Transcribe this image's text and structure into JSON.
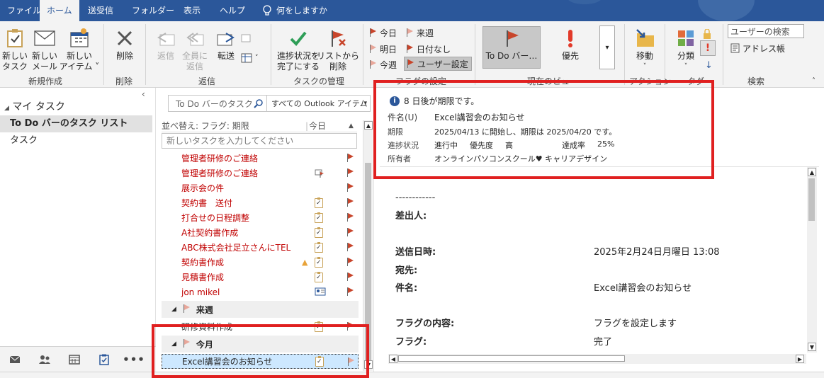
{
  "tabs": [
    {
      "label": "ファイル"
    },
    {
      "label": "ホーム"
    },
    {
      "label": "送受信"
    },
    {
      "label": "フォルダー"
    },
    {
      "label": "表示"
    },
    {
      "label": "ヘルプ"
    },
    {
      "label": "何をしますか"
    }
  ],
  "ribbon": {
    "new_task": "新しい\nタスク",
    "new_mail": "新しい\nメール",
    "new_item": "新しい\nアイテム ˅",
    "group_new": "新規作成",
    "delete": "削除",
    "group_delete": "削除",
    "reply": "返信",
    "reply_all": "全員に\n返信",
    "forward": "転送",
    "group_reply": "返信",
    "mark_complete": "進捗状況を\n完了にする",
    "remove_from_list": "リストから\n削除",
    "group_manage": "タスクの管理",
    "flag_today": "今日",
    "flag_tomorrow": "明日",
    "flag_this_week": "今週",
    "flag_next_week": "来週",
    "flag_no_date": "日付なし",
    "flag_custom": "ユーザー設定",
    "group_followup": "フラグの設定",
    "view_todo": "To Do バー…",
    "view_priority": "優先",
    "group_current_view": "現在のビュー",
    "move": "移動",
    "group_actions": "アクション",
    "categorize": "分類",
    "group_tags": "タグ",
    "search_people": "ユーザーの検索",
    "address_book": "アドレス帳",
    "group_find": "検索"
  },
  "nav": {
    "my_tasks": "マイ タスク",
    "items": [
      {
        "label": "To Do バーのタスク リスト"
      },
      {
        "label": "タスク"
      }
    ]
  },
  "tasklist": {
    "search_placeholder": "To Do バーのタスク",
    "scope": "すべての Outlook アイテム",
    "sort_label": "並べ替え: フラグ: 期限",
    "sort_col": "今日",
    "new_task_placeholder": "新しいタスクを入力してください",
    "tasks": [
      {
        "name": "管理者研修のご連絡"
      },
      {
        "name": "管理者研修のご連絡"
      },
      {
        "name": "展示会の件"
      },
      {
        "name": "契約書　送付"
      },
      {
        "name": "打合せの日程調整"
      },
      {
        "name": "A社契約書作成"
      },
      {
        "name": "ABC株式会社足立さんにTEL"
      },
      {
        "name": "契約書作成"
      },
      {
        "name": "見積書作成"
      },
      {
        "name": "jon mikel"
      }
    ],
    "group_next_week": "来週",
    "next_week_task": "研修資料作成",
    "group_this_month": "今月",
    "selected_task": "Excel講習会のお知らせ"
  },
  "reading": {
    "info": "8 日後が期限です。",
    "subject_label": "件名(U)",
    "subject": "Excel講習会のお知らせ",
    "due_label": "期限",
    "due": "2025/04/13 に開始し、期限は 2025/04/20 です。",
    "status_label": "進捗状況",
    "status": "進行中",
    "priority_label": "優先度",
    "priority": "高",
    "percent_label": "達成率",
    "percent": "25%",
    "owner_label": "所有者",
    "owner": "オンラインパソコンスクール♥ キャリアデザイン",
    "body": {
      "dashes": "------------",
      "from": "差出人:",
      "sent": "送信日時:",
      "sent_value": "2025年2月24日月曜日 13:08",
      "to": "宛先:",
      "subject": "件名:",
      "subject_value": "Excel講習会のお知らせ",
      "flag_content": "フラグの内容:",
      "flag_content_value": "フラグを設定します",
      "flag": "フラグ:",
      "flag_value": "完了"
    }
  },
  "colors": {
    "accent": "#2b579a",
    "task_red": "#c00000",
    "highlight": "#e02020"
  }
}
